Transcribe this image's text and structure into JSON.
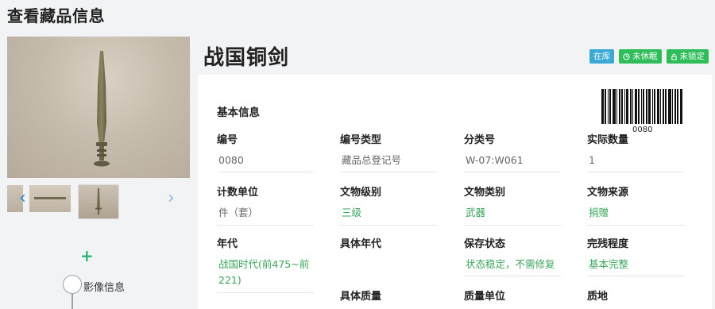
{
  "page": {
    "title": "查看藏品信息"
  },
  "artifact": {
    "name": "战国铜剑"
  },
  "badges": [
    {
      "label": "在库",
      "color": "#3aa9d6"
    },
    {
      "label": "未休眠",
      "icon": "clock-icon",
      "color": "#2ebd59"
    },
    {
      "label": "未锁定",
      "icon": "lock-icon",
      "color": "#2ebd59"
    }
  ],
  "gallery": {
    "prev_icon": "chevron-left-icon",
    "next_icon": "chevron-right-icon"
  },
  "timeline": {
    "add_label": "+",
    "node_label": "影像信息"
  },
  "basic_info": {
    "section_title": "基本信息",
    "barcode_number": "0080",
    "fields": [
      {
        "label": "编号",
        "value": "0080"
      },
      {
        "label": "编号类型",
        "value": "藏品总登记号"
      },
      {
        "label": "分类号",
        "value": "W-07:W061"
      },
      {
        "label": "实际数量",
        "value": "1"
      },
      {
        "label": "计数单位",
        "value": "件（套）"
      },
      {
        "label": "文物级别",
        "value": "三级"
      },
      {
        "label": "文物类别",
        "value": "武器"
      },
      {
        "label": "文物来源",
        "value": "捐赠"
      },
      {
        "label": "年代",
        "value": "战国时代(前475~前221)"
      },
      {
        "label": "具体年代",
        "value": ""
      },
      {
        "label": "保存状态",
        "value": "状态稳定，不需修复"
      },
      {
        "label": "完残程度",
        "value": "基本完整"
      },
      {
        "label": "具体质量",
        "value": ""
      },
      {
        "label": "质量单位",
        "value": ""
      },
      {
        "label": "质地",
        "value": ""
      }
    ]
  },
  "colors": {
    "accent_green": "#2ebd59",
    "accent_blue": "#3aa9d6",
    "value_green": "#3ba55c"
  }
}
